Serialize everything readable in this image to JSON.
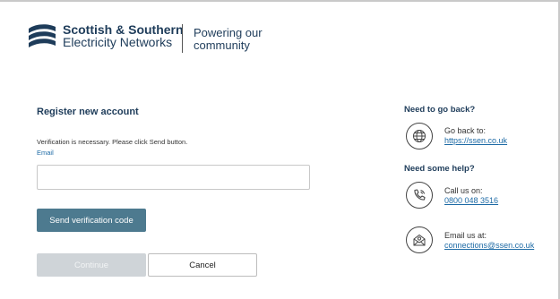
{
  "header": {
    "brand_line1": "Scottish & Southern",
    "brand_line2": "Electricity Networks",
    "tagline_line1": "Powering our",
    "tagline_line2": "community",
    "brand_color": "#1e3c5a"
  },
  "form": {
    "title": "Register new account",
    "info": "Verification is necessary. Please click Send button.",
    "email_label": "Email",
    "email_value": "",
    "email_placeholder": "",
    "send_button": "Send verification code",
    "continue_button": "Continue",
    "cancel_button": "Cancel",
    "accent_color": "#4d7a8f"
  },
  "side": {
    "back_title": "Need to go back?",
    "back_label": "Go back to:",
    "back_link": "https://ssen.co.uk",
    "back_icon": "globe-icon",
    "help_title": "Need some help?",
    "call_label": "Call us on:",
    "call_link": "0800 048 3516",
    "call_icon": "phone-icon",
    "email_label": "Email us at:",
    "email_link": "connections@ssen.co.uk",
    "email_icon": "envelope-icon",
    "link_color": "#1d6aa5"
  }
}
